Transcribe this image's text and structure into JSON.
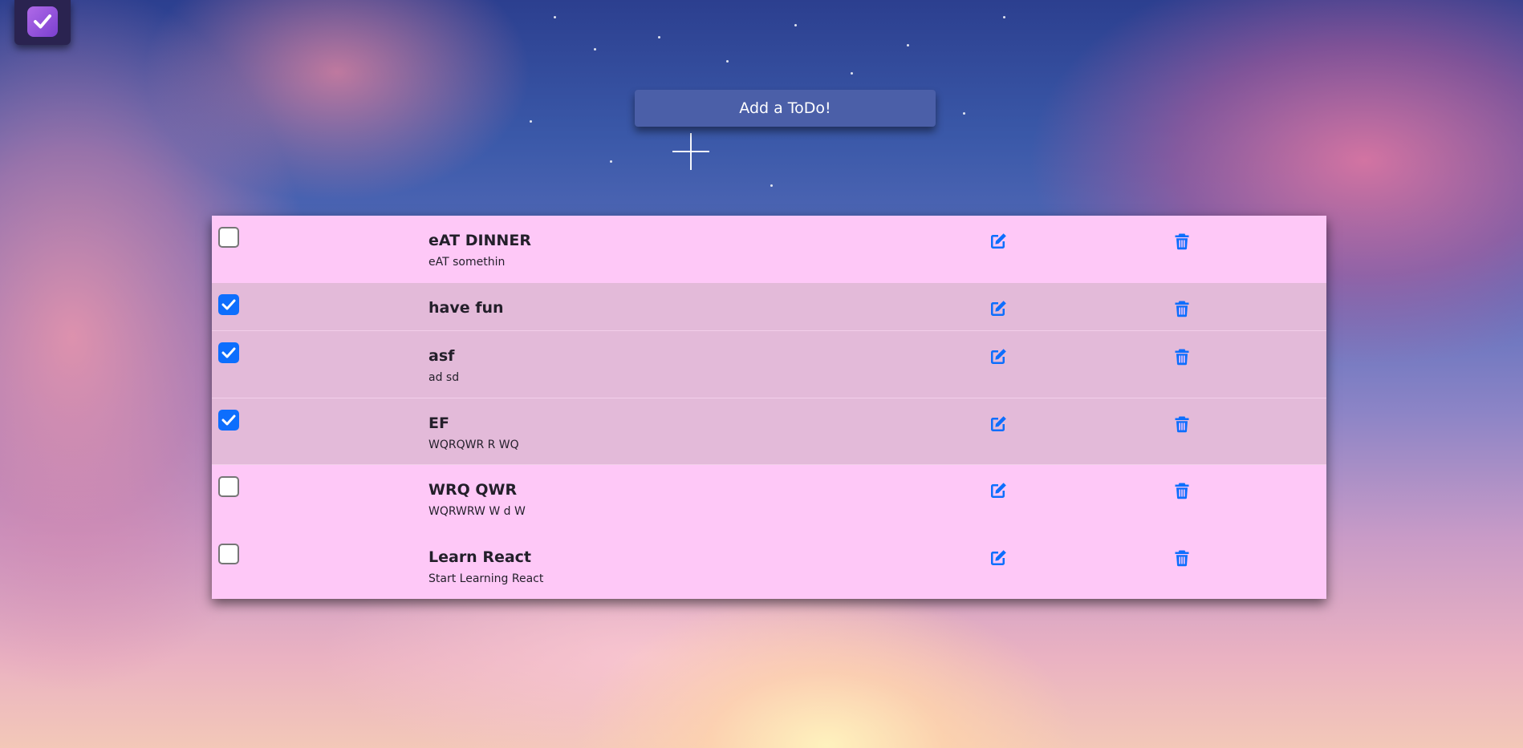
{
  "app": {
    "logo_icon": "check-square-icon"
  },
  "header": {
    "add_button_label": "Add a ToDo!"
  },
  "colors": {
    "row_unchecked": "#fec8f7",
    "row_checked": "#e3bad9",
    "accent": "#0d6efd",
    "add_button": "#4b5fa8"
  },
  "todos": [
    {
      "title": "eAT DINNER",
      "description": "eAT somethin",
      "completed": false
    },
    {
      "title": "have fun",
      "description": "",
      "completed": true
    },
    {
      "title": "asf",
      "description": "ad sd",
      "completed": true
    },
    {
      "title": "EF",
      "description": "WQRQWR R WQ",
      "completed": true
    },
    {
      "title": "WRQ QWR",
      "description": "WQRWRW W d W",
      "completed": false
    },
    {
      "title": "Learn React",
      "description": "Start Learning React",
      "completed": false
    }
  ],
  "icons": {
    "edit": "edit-icon",
    "delete": "trash-icon"
  }
}
